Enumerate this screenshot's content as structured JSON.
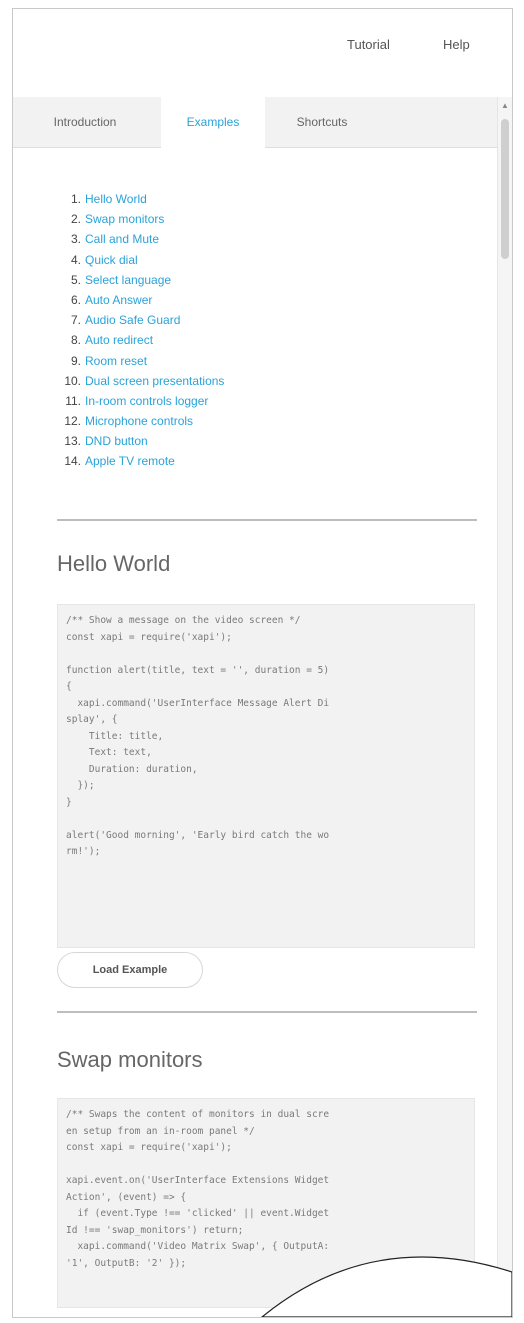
{
  "topnav": {
    "tutorial": "Tutorial",
    "help": "Help"
  },
  "tabs": [
    "Introduction",
    "Examples",
    "Shortcuts"
  ],
  "toc": [
    {
      "num": "1.",
      "label": "Hello World"
    },
    {
      "num": "2.",
      "label": "Swap monitors"
    },
    {
      "num": "3.",
      "label": "Call and Mute"
    },
    {
      "num": "4.",
      "label": "Quick dial"
    },
    {
      "num": "5.",
      "label": "Select language"
    },
    {
      "num": "6.",
      "label": "Auto Answer"
    },
    {
      "num": "7.",
      "label": "Audio Safe Guard"
    },
    {
      "num": "8.",
      "label": "Auto redirect"
    },
    {
      "num": "9.",
      "label": "Room reset"
    },
    {
      "num": "10.",
      "label": "Dual screen presentations"
    },
    {
      "num": "11.",
      "label": "In-room controls logger"
    },
    {
      "num": "12.",
      "label": "Microphone controls"
    },
    {
      "num": "13.",
      "label": "DND button"
    },
    {
      "num": "14.",
      "label": "Apple TV remote"
    }
  ],
  "section1": {
    "title": "Hello World",
    "code": [
      "/** Show a message on the video screen */",
      "const xapi = require('xapi');",
      "",
      "function alert(title, text = '', duration = 5)",
      "{",
      "  xapi.command('UserInterface Message Alert Di",
      "splay', {",
      "    Title: title,",
      "    Text: text,",
      "    Duration: duration,",
      "  });",
      "}",
      "",
      "alert('Good morning', 'Early bird catch the wo",
      "rm!');"
    ],
    "button": "Load Example"
  },
  "section2": {
    "title": "Swap monitors",
    "code": [
      "/** Swaps the content of monitors in dual scre",
      "en setup from an in-room panel */",
      "const xapi = require('xapi');",
      "",
      "xapi.event.on('UserInterface Extensions Widget",
      "Action', (event) => {",
      "  if (event.Type !== 'clicked' || event.Widget",
      "Id !== 'swap_monitors') return;",
      "  xapi.command('Video Matrix Swap', { OutputA:",
      "'1', OutputB: '2' });"
    ]
  }
}
